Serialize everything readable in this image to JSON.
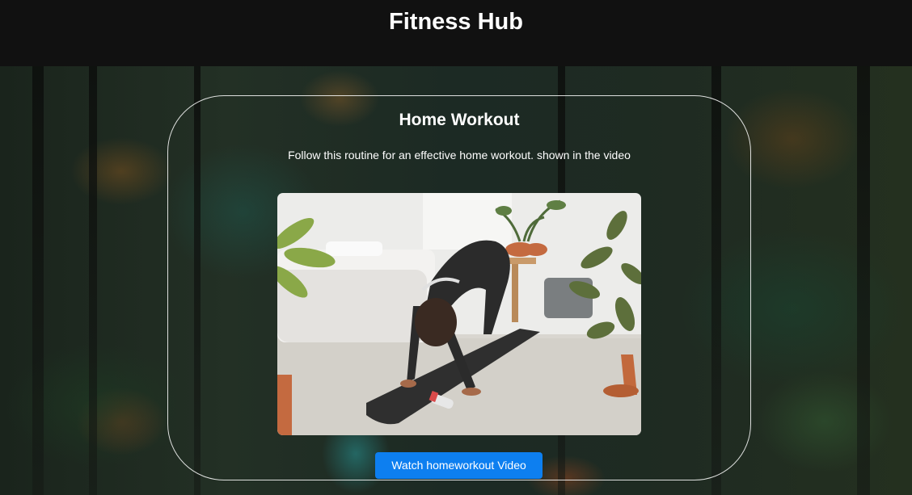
{
  "header": {
    "title": "Fitness Hub"
  },
  "workout": {
    "title": "Home Workout",
    "description": "Follow this routine for an effective home workout. shown in the video",
    "button_label": "Watch homeworkout Video"
  },
  "colors": {
    "header_bg": "#111111",
    "button_bg": "#0d7ff0",
    "card_border": "#ffffff"
  }
}
